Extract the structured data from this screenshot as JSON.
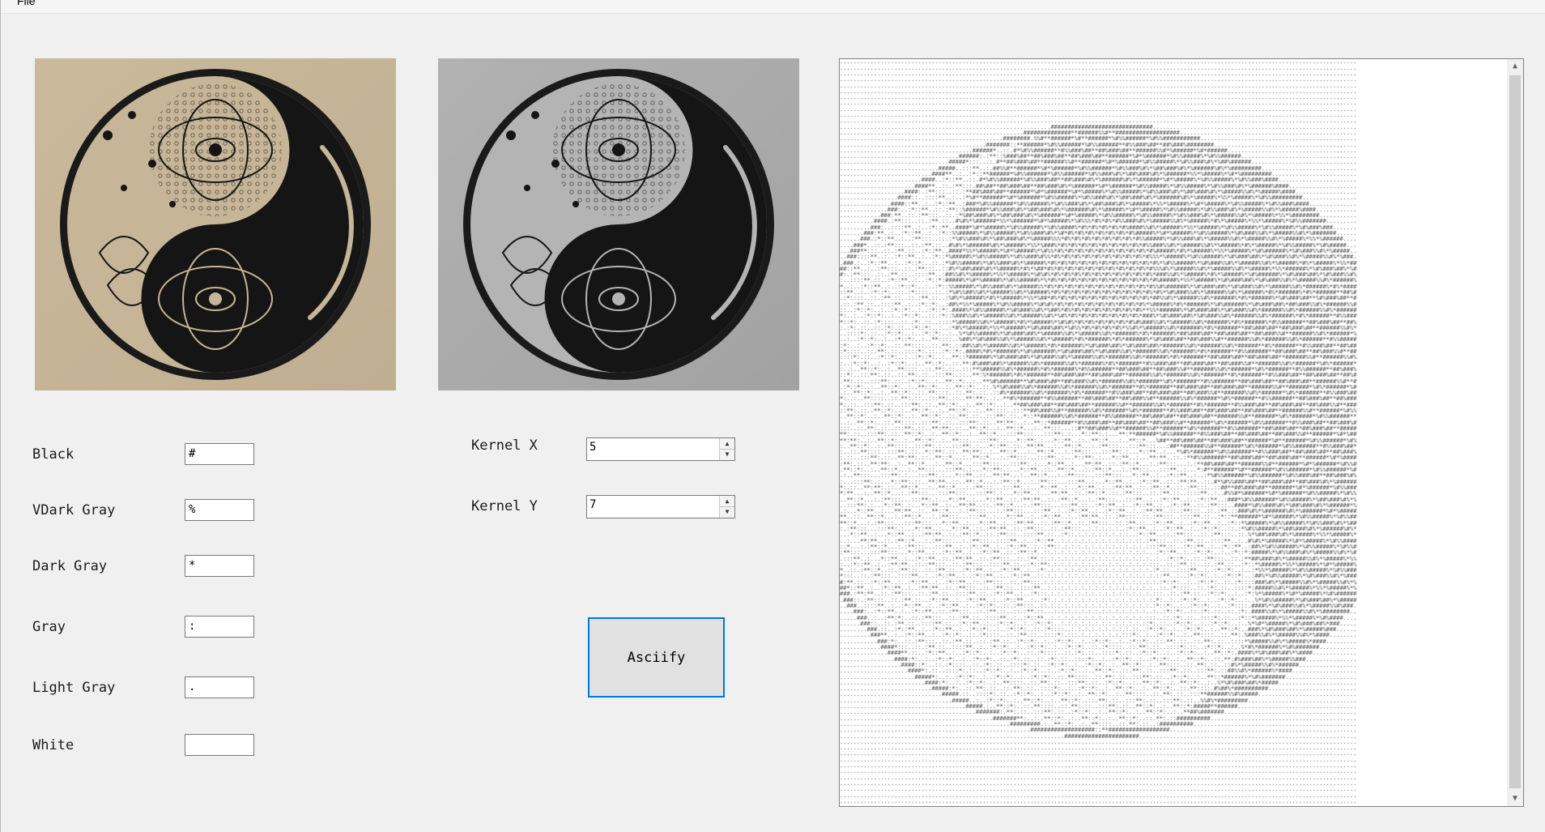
{
  "menu": {
    "file_label": "File"
  },
  "images": {
    "original": {
      "icon": "yin-yang-mandala-image",
      "tone": "#c9b79a"
    },
    "grayscale": {
      "icon": "yin-yang-mandala-grayscale-image",
      "tone": "#a9a9a9"
    }
  },
  "char_map": [
    {
      "label": "Black",
      "value": "#"
    },
    {
      "label": "VDark Gray",
      "value": "%"
    },
    {
      "label": "Dark Gray",
      "value": "*"
    },
    {
      "label": "Gray",
      "value": ":"
    },
    {
      "label": "Light Gray",
      "value": "."
    },
    {
      "label": "White",
      "value": ""
    }
  ],
  "kernel": {
    "x_label": "Kernel X",
    "x_value": "5",
    "y_label": "Kernel Y",
    "y_value": "7"
  },
  "action": {
    "asciify_label": "Asciify"
  },
  "output": {
    "content": "ascii-art rendering of yin-yang mandala"
  },
  "colors": {
    "accent": "#0078d7",
    "window_bg": "#f0f0f0"
  }
}
